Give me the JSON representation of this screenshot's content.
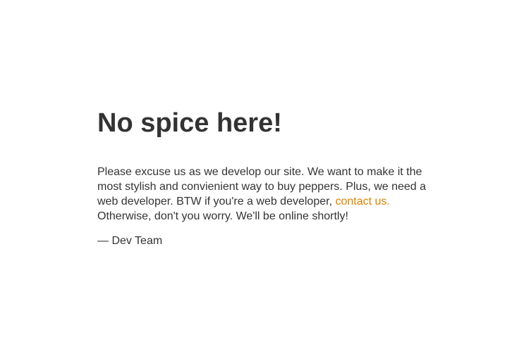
{
  "page": {
    "title": "No spice here!",
    "body_before_link": "Please excuse us as we develop our site. We want to make it the most stylish and convienient way to buy peppers. Plus, we need a web developer. BTW if you're a web developer, ",
    "link_text": "contact us.",
    "body_after_link": " Otherwise, don't you worry. We'll be online shortly!",
    "signature": "— Dev Team"
  },
  "colors": {
    "text": "#333333",
    "link": "#dc8100",
    "background": "#ffffff"
  }
}
